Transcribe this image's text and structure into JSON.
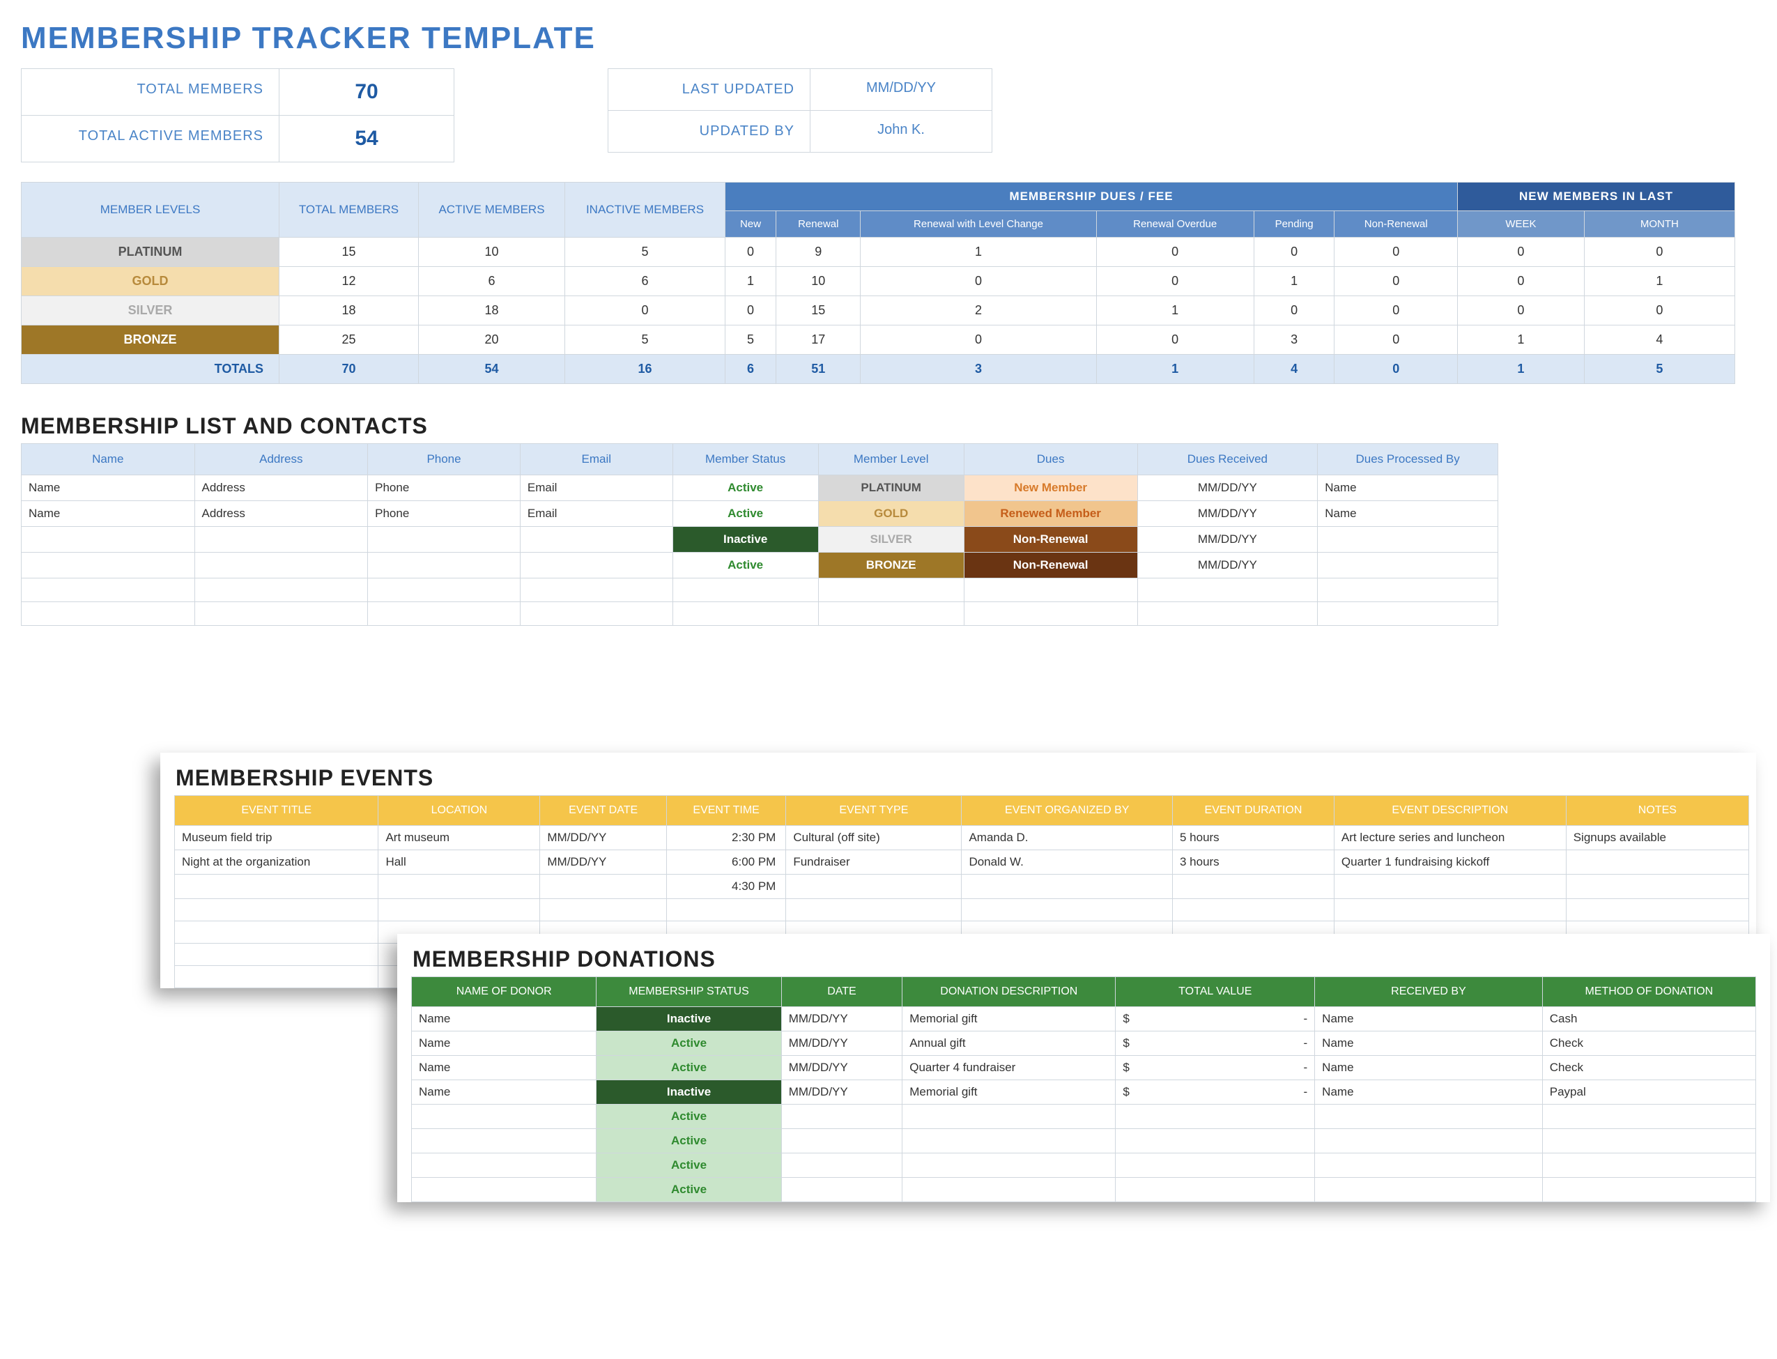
{
  "title": "MEMBERSHIP TRACKER TEMPLATE",
  "summary": {
    "total_members_label": "TOTAL MEMBERS",
    "total_members": "70",
    "active_members_label": "TOTAL ACTIVE MEMBERS",
    "active_members": "54",
    "last_updated_label": "LAST UPDATED",
    "last_updated": "MM/DD/YY",
    "updated_by_label": "UPDATED BY",
    "updated_by": "John K."
  },
  "levels": {
    "headers": {
      "member_levels": "MEMBER LEVELS",
      "total": "TOTAL MEMBERS",
      "active": "ACTIVE MEMBERS",
      "inactive": "INACTIVE MEMBERS",
      "dues_group": "MEMBERSHIP DUES / FEE",
      "newm_group": "NEW MEMBERS IN LAST",
      "new": "New",
      "renewal": "Renewal",
      "renewal_change": "Renewal with Level Change",
      "renewal_overdue": "Renewal Overdue",
      "pending": "Pending",
      "non_renewal": "Non-Renewal",
      "week": "WEEK",
      "month": "MONTH"
    },
    "rows": [
      {
        "name": "PLATINUM",
        "cls": "lvl-platinum",
        "vals": [
          "15",
          "10",
          "5",
          "0",
          "9",
          "1",
          "0",
          "0",
          "0",
          "0",
          "0"
        ]
      },
      {
        "name": "GOLD",
        "cls": "lvl-gold",
        "vals": [
          "12",
          "6",
          "6",
          "1",
          "10",
          "0",
          "0",
          "1",
          "0",
          "0",
          "1"
        ]
      },
      {
        "name": "SILVER",
        "cls": "lvl-silver",
        "vals": [
          "18",
          "18",
          "0",
          "0",
          "15",
          "2",
          "1",
          "0",
          "0",
          "0",
          "0"
        ]
      },
      {
        "name": "BRONZE",
        "cls": "lvl-bronze",
        "vals": [
          "25",
          "20",
          "5",
          "5",
          "17",
          "0",
          "0",
          "3",
          "0",
          "1",
          "4"
        ]
      }
    ],
    "totals": {
      "label": "TOTALS",
      "vals": [
        "70",
        "54",
        "16",
        "6",
        "51",
        "3",
        "1",
        "4",
        "0",
        "1",
        "5"
      ]
    }
  },
  "contacts": {
    "title": "MEMBERSHIP LIST AND CONTACTS",
    "headers": [
      "Name",
      "Address",
      "Phone",
      "Email",
      "Member Status",
      "Member Level",
      "Dues",
      "Dues Received",
      "Dues Processed By"
    ],
    "rows": [
      {
        "c": [
          "Name",
          "Address",
          "Phone",
          "Email"
        ],
        "status": "Active",
        "status_cls": "status-active",
        "level": "PLATINUM",
        "level_cls": "lvl-platinum-cell",
        "dues": "New Member",
        "dues_cls": "dues-new",
        "recv": "MM/DD/YY",
        "proc": "Name"
      },
      {
        "c": [
          "Name",
          "Address",
          "Phone",
          "Email"
        ],
        "status": "Active",
        "status_cls": "status-active",
        "level": "GOLD",
        "level_cls": "lvl-gold-cell",
        "dues": "Renewed Member",
        "dues_cls": "dues-renew",
        "recv": "MM/DD/YY",
        "proc": "Name"
      },
      {
        "c": [
          "",
          "",
          "",
          ""
        ],
        "status": "Inactive",
        "status_cls": "status-inactive",
        "level": "SILVER",
        "level_cls": "lvl-silver-cell",
        "dues": "Non-Renewal",
        "dues_cls": "dues-nonr",
        "recv": "MM/DD/YY",
        "proc": ""
      },
      {
        "c": [
          "",
          "",
          "",
          ""
        ],
        "status": "Active",
        "status_cls": "status-active",
        "level": "BRONZE",
        "level_cls": "lvl-bronze-cell",
        "dues": "Non-Renewal",
        "dues_cls": "dues-nonr2",
        "recv": "MM/DD/YY",
        "proc": ""
      }
    ]
  },
  "events": {
    "title": "MEMBERSHIP EVENTS",
    "headers": [
      "EVENT TITLE",
      "LOCATION",
      "EVENT DATE",
      "EVENT TIME",
      "EVENT TYPE",
      "EVENT ORGANIZED BY",
      "EVENT DURATION",
      "EVENT DESCRIPTION",
      "NOTES"
    ],
    "rows": [
      [
        "Museum field trip",
        "Art museum",
        "MM/DD/YY",
        "2:30 PM",
        "Cultural (off site)",
        "Amanda D.",
        "5 hours",
        "Art lecture series and luncheon",
        "Signups available"
      ],
      [
        "Night at the organization",
        "Hall",
        "MM/DD/YY",
        "6:00 PM",
        "Fundraiser",
        "Donald W.",
        "3 hours",
        "Quarter 1 fundraising kickoff",
        ""
      ],
      [
        "",
        "",
        "",
        "4:30 PM",
        "",
        "",
        "",
        "",
        ""
      ]
    ]
  },
  "donations": {
    "title": "MEMBERSHIP DONATIONS",
    "headers": [
      "NAME OF DONOR",
      "MEMBERSHIP STATUS",
      "DATE",
      "DONATION DESCRIPTION",
      "TOTAL VALUE",
      "RECEIVED BY",
      "METHOD OF DONATION"
    ],
    "rows": [
      {
        "name": "Name",
        "status": "Inactive",
        "scls": "don-inactive",
        "date": "MM/DD/YY",
        "desc": "Memorial gift",
        "tv_d": "$",
        "tv_v": "-",
        "recv": "Name",
        "method": "Cash"
      },
      {
        "name": "Name",
        "status": "Active",
        "scls": "don-active",
        "date": "MM/DD/YY",
        "desc": "Annual gift",
        "tv_d": "$",
        "tv_v": "-",
        "recv": "Name",
        "method": "Check"
      },
      {
        "name": "Name",
        "status": "Active",
        "scls": "don-active",
        "date": "MM/DD/YY",
        "desc": "Quarter 4 fundraiser",
        "tv_d": "$",
        "tv_v": "-",
        "recv": "Name",
        "method": "Check"
      },
      {
        "name": "Name",
        "status": "Inactive",
        "scls": "don-inactive",
        "date": "MM/DD/YY",
        "desc": "Memorial gift",
        "tv_d": "$",
        "tv_v": "-",
        "recv": "Name",
        "method": "Paypal"
      },
      {
        "name": "",
        "status": "Active",
        "scls": "don-active",
        "date": "",
        "desc": "",
        "tv_d": "",
        "tv_v": "",
        "recv": "",
        "method": ""
      },
      {
        "name": "",
        "status": "Active",
        "scls": "don-active",
        "date": "",
        "desc": "",
        "tv_d": "",
        "tv_v": "",
        "recv": "",
        "method": ""
      },
      {
        "name": "",
        "status": "Active",
        "scls": "don-active",
        "date": "",
        "desc": "",
        "tv_d": "",
        "tv_v": "",
        "recv": "",
        "method": ""
      },
      {
        "name": "",
        "status": "Active",
        "scls": "don-active",
        "date": "",
        "desc": "",
        "tv_d": "",
        "tv_v": "",
        "recv": "",
        "method": ""
      }
    ]
  }
}
